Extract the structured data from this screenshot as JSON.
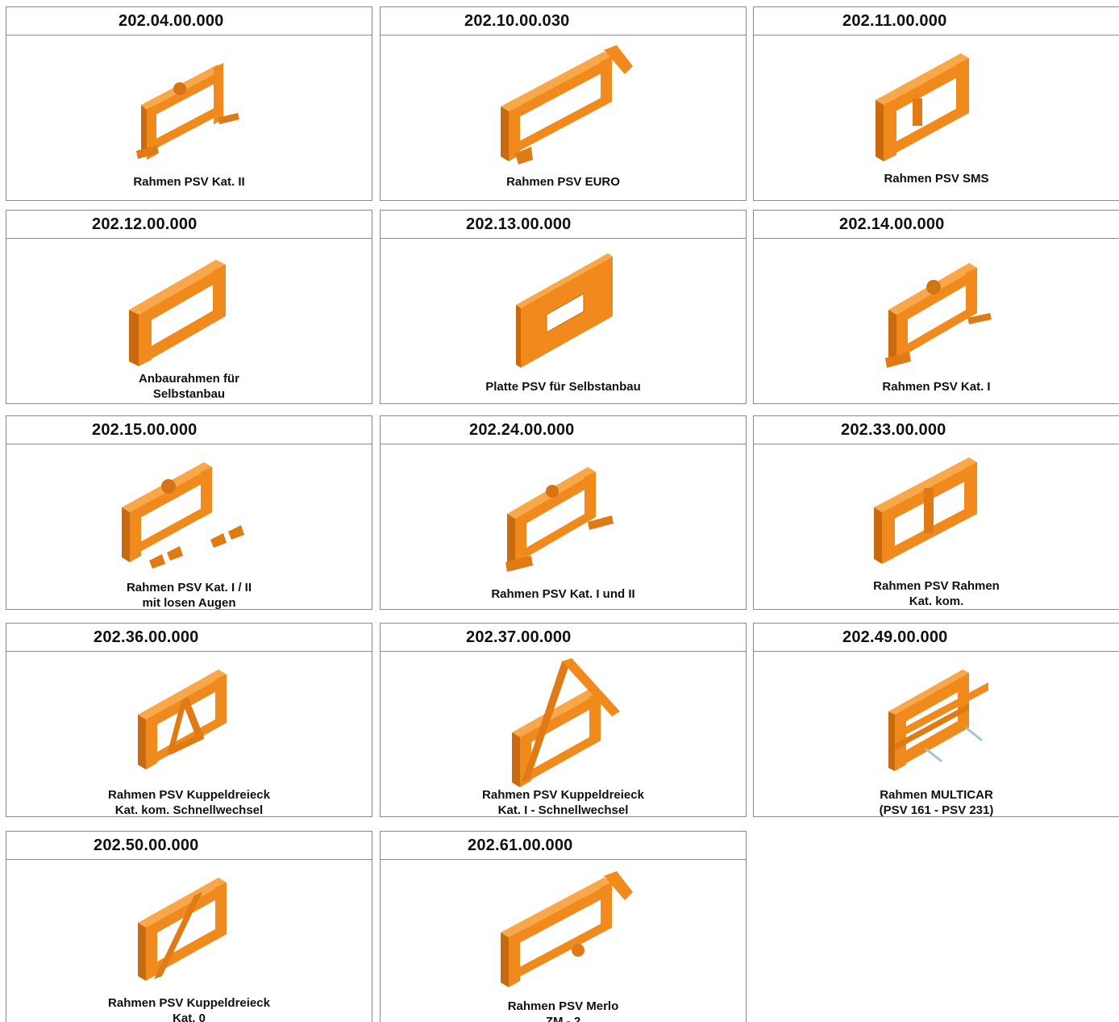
{
  "colors": {
    "frame": "#f08a1c",
    "frame_dark": "#c86a10",
    "frame_light": "#f8a84a",
    "border": "#8a8a8a"
  },
  "items": [
    {
      "code": "202.04.00.000",
      "caption": [
        "Rahmen PSV Kat. II"
      ],
      "icon": "frame-kat2-icon"
    },
    {
      "code": "202.10.00.030",
      "caption": [
        "Rahmen PSV EURO"
      ],
      "icon": "frame-euro-icon"
    },
    {
      "code": "202.11.00.000",
      "caption": [
        "Rahmen PSV SMS"
      ],
      "icon": "frame-sms-icon"
    },
    {
      "code": "202.12.00.000",
      "caption": [
        "Anbaurahmen für",
        "Selbstanbau"
      ],
      "icon": "frame-selbstanbau-icon"
    },
    {
      "code": "202.13.00.000",
      "caption": [
        "Platte PSV für Selbstanbau"
      ],
      "icon": "plate-icon"
    },
    {
      "code": "202.14.00.000",
      "caption": [
        "Rahmen PSV Kat. I"
      ],
      "icon": "frame-kat1-icon"
    },
    {
      "code": "202.15.00.000",
      "caption": [
        "Rahmen PSV Kat. I / II",
        "mit losen Augen"
      ],
      "icon": "frame-loose-eyes-icon"
    },
    {
      "code": "202.24.00.000",
      "caption": [
        "Rahmen PSV  Kat. I und II"
      ],
      "icon": "frame-kat1-2-icon"
    },
    {
      "code": "202.33.00.000",
      "caption": [
        "Rahmen PSV Rahmen",
        "Kat. kom."
      ],
      "icon": "frame-kom-icon"
    },
    {
      "code": "202.36.00.000",
      "caption": [
        "Rahmen PSV Kuppeldreieck",
        "Kat. kom. Schnellwechsel"
      ],
      "icon": "frame-triangle-icon"
    },
    {
      "code": "202.37.00.000",
      "caption": [
        "Rahmen PSV Kuppeldreieck",
        "Kat. I - Schnellwechsel"
      ],
      "icon": "frame-triangle-kat1-icon"
    },
    {
      "code": "202.49.00.000",
      "caption": [
        "Rahmen MULTICAR",
        "(PSV 161 - PSV 231)"
      ],
      "icon": "frame-multicar-icon"
    },
    {
      "code": "202.50.00.000",
      "caption": [
        "Rahmen PSV Kuppeldreieck",
        "Kat. 0"
      ],
      "icon": "frame-triangle-kat0-icon"
    },
    {
      "code": "202.61.00.000",
      "caption": [
        "Rahmen PSV  Merlo",
        "ZM - 2"
      ],
      "icon": "frame-merlo-icon"
    }
  ]
}
